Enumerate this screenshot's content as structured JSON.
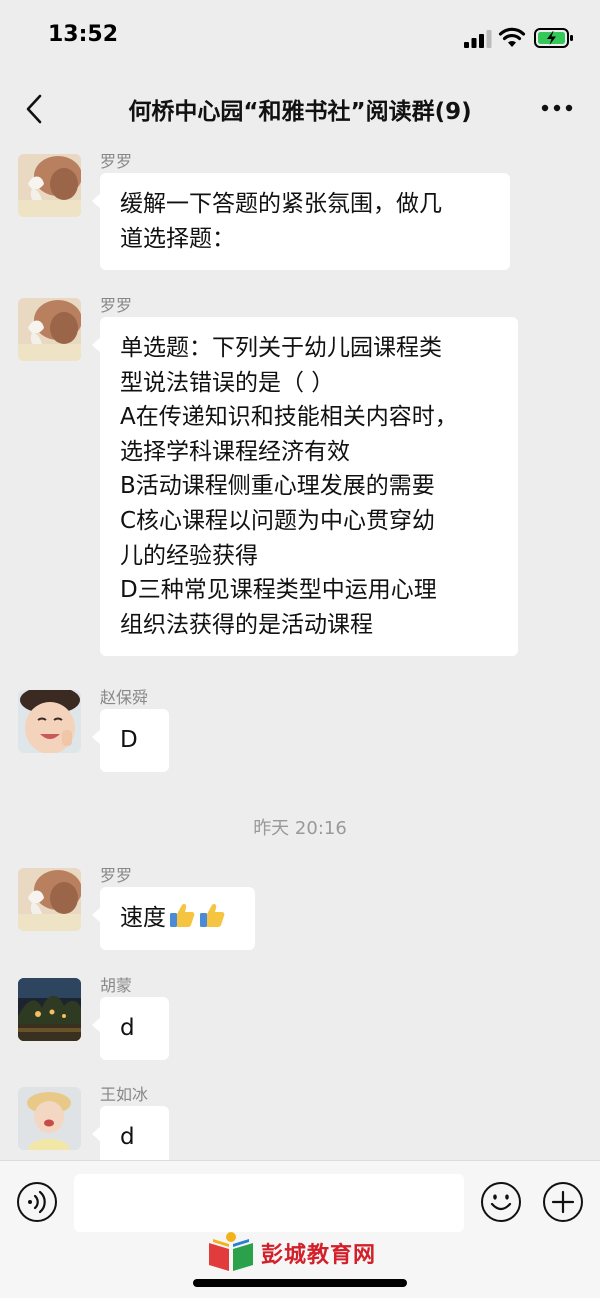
{
  "status_bar": {
    "time": "13:52"
  },
  "header": {
    "title": "何桥中心园“和雅书社”阅读群(9)"
  },
  "messages": [
    {
      "sender": "罗罗",
      "avatar": "girl-bow-avatar",
      "lines": [
        "缓解一下答题的紧张氛围，做几",
        "道选择题："
      ]
    },
    {
      "sender": "罗罗",
      "avatar": "girl-bow-avatar",
      "lines": [
        "单选题：下列关于幼儿园课程类",
        "型说法错误的是（ ）",
        "A在传递知识和技能相关内容时，",
        "选择学科课程经济有效",
        "B活动课程侧重心理发展的需要",
        "C核心课程以问题为中心贯穿幼",
        "儿的经验获得",
        "D三种常见课程类型中运用心理",
        "组织法获得的是活动课程"
      ]
    },
    {
      "sender": "赵保舜",
      "avatar": "smiling-boy-avatar",
      "lines": [
        "D"
      ]
    },
    {
      "sender": "罗罗",
      "avatar": "girl-bow-avatar",
      "lines": [
        "速度"
      ],
      "emoji": [
        "thumbs-up",
        "thumbs-up"
      ]
    },
    {
      "sender": "胡蒙",
      "avatar": "night-garden-avatar",
      "lines": [
        "d"
      ]
    },
    {
      "sender": "王如冰",
      "avatar": "girl-hat-avatar",
      "lines": [
        "d"
      ]
    }
  ],
  "timestamp": "昨天 20:16",
  "input_bar": {
    "voice_icon": "voice-icon",
    "emoji_icon": "emoji-icon",
    "plus_icon": "plus-icon"
  },
  "watermark": {
    "text": "彭城教育网"
  },
  "colors": {
    "background": "#ededed",
    "bubble": "#ffffff",
    "sender": "#888888",
    "watermark": "#d21f2a"
  }
}
